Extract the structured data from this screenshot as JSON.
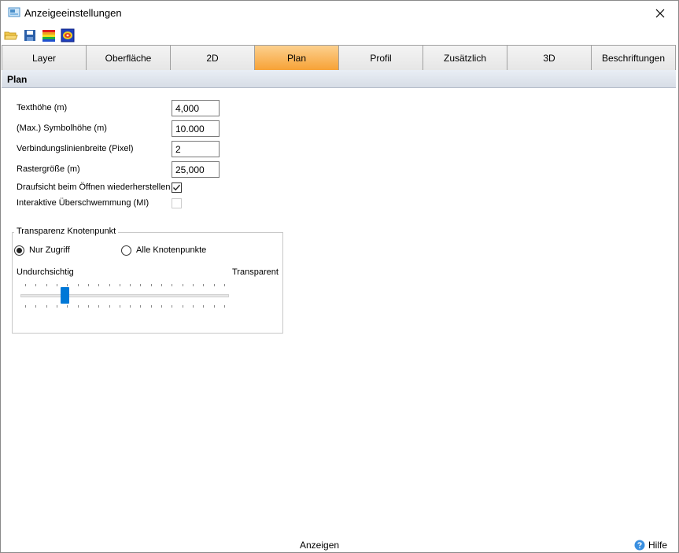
{
  "window": {
    "title": "Anzeigeeinstellungen"
  },
  "toolbar": {
    "icons": [
      "open-folder-icon",
      "save-icon",
      "color-palette-icon",
      "color-map-icon"
    ]
  },
  "tabs": [
    {
      "label": "Layer",
      "active": false
    },
    {
      "label": "Oberfläche",
      "active": false
    },
    {
      "label": "2D",
      "active": false
    },
    {
      "label": "Plan",
      "active": true
    },
    {
      "label": "Profil",
      "active": false
    },
    {
      "label": "Zusätzlich",
      "active": false
    },
    {
      "label": "3D",
      "active": false
    },
    {
      "label": "Beschriftungen",
      "active": false
    }
  ],
  "section": {
    "title": "Plan"
  },
  "fields": {
    "text_height": {
      "label": "Texthöhe (m)",
      "value": "4,000"
    },
    "symbol_height": {
      "label": "(Max.) Symbolhöhe (m)",
      "value": "10.000"
    },
    "line_width": {
      "label": "Verbindungslinienbreite (Pixel)",
      "value": "2"
    },
    "grid_size": {
      "label": "Rastergröße (m)",
      "value": "25,000"
    }
  },
  "checks": {
    "restore_topview": {
      "label": "Draufsicht beim Öffnen wiederherstellen",
      "checked": true,
      "enabled": true
    },
    "interactive_flood": {
      "label": "Interaktive Überschwemmung (MI)",
      "checked": false,
      "enabled": false
    }
  },
  "transparency": {
    "legend": "Transparenz Knotenpunkt",
    "options": [
      {
        "label": "Nur Zugriff",
        "selected": true
      },
      {
        "label": "Alle Knotenpunkte",
        "selected": false
      }
    ],
    "min_label": "Undurchsichtig",
    "max_label": "Transparent",
    "slider_value": 0.2,
    "colors": {
      "thumb": "#0078d7"
    }
  },
  "status": {
    "center_label": "Anzeigen",
    "help_label": "Hilfe"
  },
  "colors": {
    "active_tab_top": "#fcd08e",
    "active_tab_bottom": "#f7a236"
  }
}
